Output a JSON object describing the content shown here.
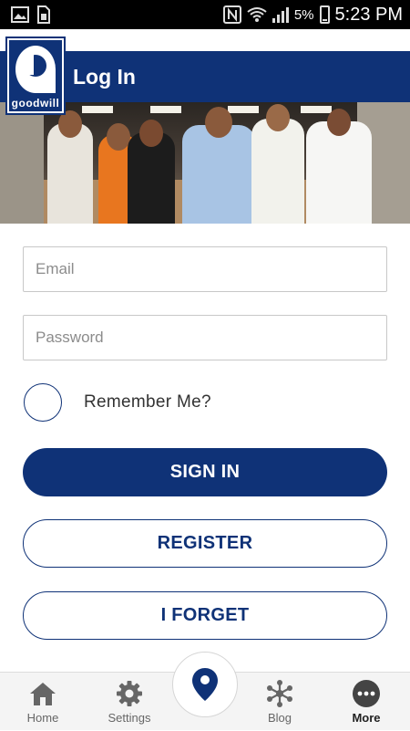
{
  "status_bar": {
    "battery_percent": "5%",
    "time": "5:23 PM",
    "icons": [
      "image-icon",
      "sim-card-icon",
      "nfc-icon",
      "wifi-icon",
      "cell-signal-icon",
      "battery-icon"
    ]
  },
  "header": {
    "title": "Log In",
    "logo_text": "goodwill"
  },
  "form": {
    "email_placeholder": "Email",
    "password_placeholder": "Password",
    "remember_label": "Remember Me?"
  },
  "buttons": {
    "sign_in": "SIGN IN",
    "register": "REGISTER",
    "forget": "I FORGET"
  },
  "tabbar": {
    "items": [
      {
        "label": "Home",
        "icon": "home-icon"
      },
      {
        "label": "Settings",
        "icon": "gear-icon"
      },
      {
        "label": "Blog",
        "icon": "blog-icon"
      },
      {
        "label": "More",
        "icon": "more-icon"
      }
    ],
    "center_icon": "location-pin-icon",
    "active": "More"
  },
  "colors": {
    "brand_blue": "#0f3277",
    "status_bar": "#000000",
    "tabbar_bg": "#f4f4f4"
  }
}
